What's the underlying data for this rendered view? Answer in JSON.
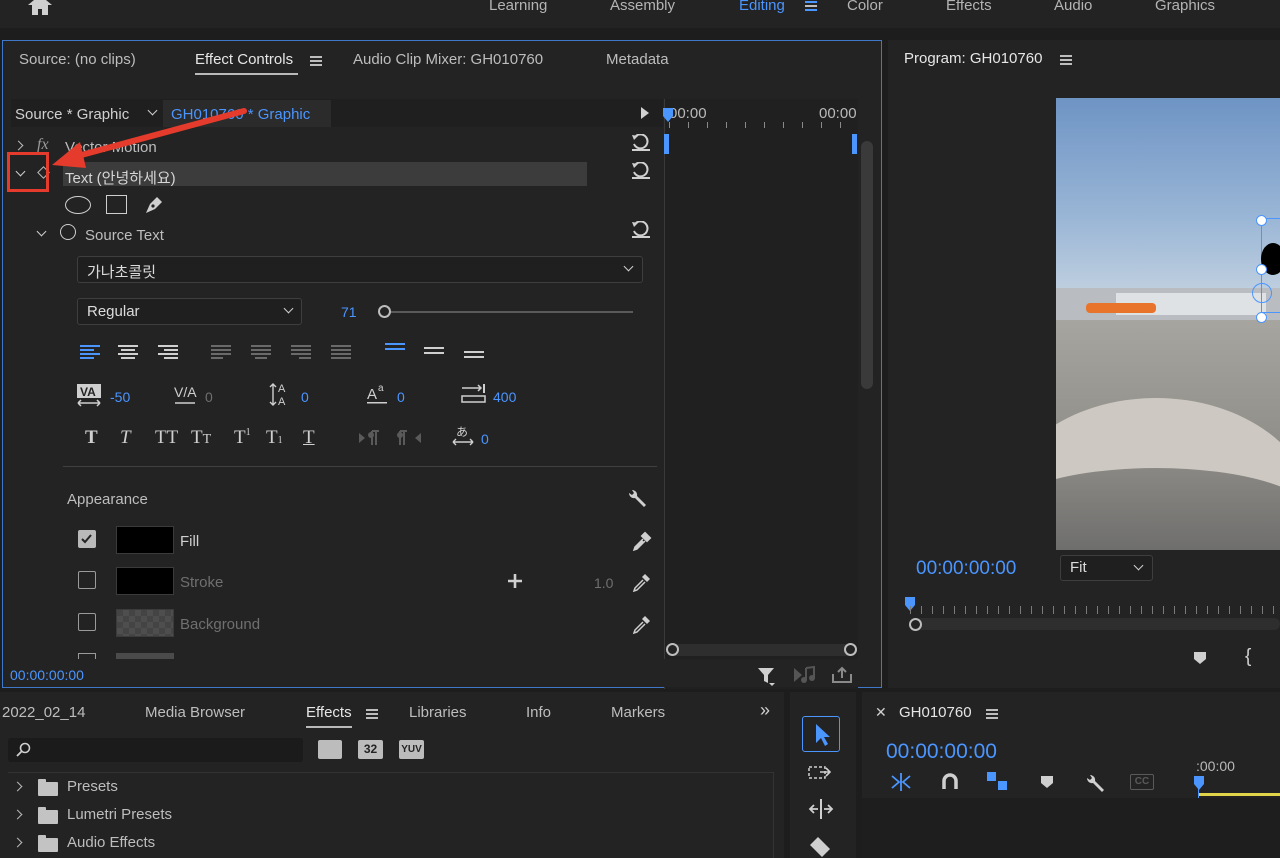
{
  "workspace": {
    "tabs": [
      "Learning",
      "Assembly",
      "Editing",
      "Color",
      "Effects",
      "Audio",
      "Graphics"
    ],
    "active_tab": "Editing"
  },
  "effect_panel": {
    "tabs": [
      "Source: (no clips)",
      "Effect Controls",
      "Audio Clip Mixer: GH010760",
      "Metadata"
    ],
    "active_tab": "Effect Controls",
    "source_label": "Source * Graphic",
    "clip_label": "GH010760 * Graphic",
    "timeline_start": "00:00",
    "timeline_end": "00:00",
    "vector_motion_label": "Vector Motion",
    "text_layer_label": "Text (안녕하세요)",
    "source_text_label": "Source Text",
    "font_name": "가나초콜릿",
    "font_style": "Regular",
    "font_size": "71",
    "font_size_level": 0.0,
    "kerning": "-50",
    "tracking": "0",
    "leading": "0",
    "baseline_shift": "0",
    "tsume": "400",
    "extra_value": "0",
    "appearance_label": "Appearance",
    "fill_label": "Fill",
    "fill_checked": true,
    "stroke_label": "Stroke",
    "stroke_checked": false,
    "stroke_width": "1.0",
    "background_label": "Background",
    "background_checked": false,
    "timecode": "00:00:00:00",
    "fill_color": "#000000",
    "stroke_color": "#000000"
  },
  "program_panel": {
    "title": "Program: GH010760",
    "timecode": "00:00:00:00",
    "zoom": "Fit"
  },
  "project_panel": {
    "tabs": [
      "2022_02_14",
      "Media Browser",
      "Effects",
      "Libraries",
      "Info",
      "Markers"
    ],
    "active_tab": "Effects",
    "search_placeholder": "",
    "items": [
      "Presets",
      "Lumetri Presets",
      "Audio Effects"
    ],
    "filter_badges": [
      "32",
      "YUV"
    ]
  },
  "timeline_panel": {
    "title": "GH010760",
    "timecode": "00:00:00:00",
    "ruler_label": ":00:00"
  },
  "colors": {
    "accent": "#4b95ff",
    "annotation": "#e53b2c",
    "panel": "#232323"
  }
}
